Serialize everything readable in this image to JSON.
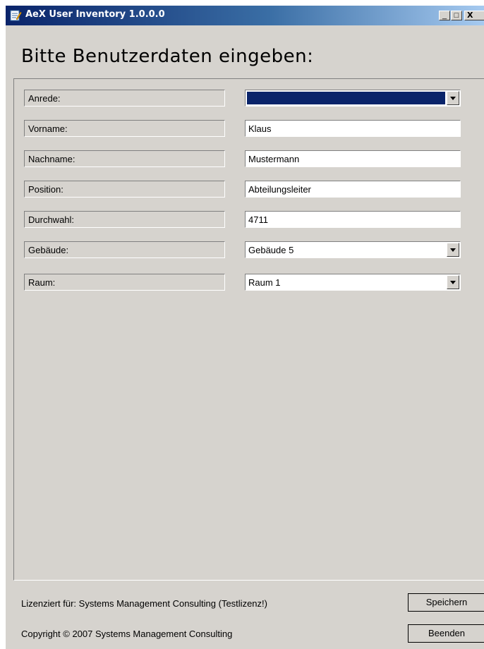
{
  "window": {
    "title": "AeX User Inventory 1.0.0.0",
    "controls": {
      "minimize": "_",
      "maximize": "□",
      "close": "X"
    }
  },
  "heading": "Bitte Benutzerdaten eingeben:",
  "form": {
    "fields": [
      {
        "label": "Anrede:",
        "type": "select",
        "value": "",
        "selected_highlight": true
      },
      {
        "label": "Vorname:",
        "type": "text",
        "value": "Klaus"
      },
      {
        "label": "Nachname:",
        "type": "text",
        "value": "Mustermann"
      },
      {
        "label": "Position:",
        "type": "text",
        "value": "Abteilungsleiter"
      },
      {
        "label": "Durchwahl:",
        "type": "text",
        "value": "4711"
      },
      {
        "label": "Gebäude:",
        "type": "select",
        "value": "Gebäude 5"
      },
      {
        "label": "Raum:",
        "type": "select",
        "value": "Raum 1"
      }
    ]
  },
  "footer": {
    "license": "Lizenziert für: Systems Management Consulting (Testlizenz!)",
    "copyright": "Copyright © 2007 Systems Management Consulting",
    "save_label": "Speichern",
    "exit_label": "Beenden"
  },
  "colors": {
    "titlebar_start": "#0a246a",
    "titlebar_end": "#a6caf0",
    "window_bg": "#d6d3ce",
    "selection": "#0a246a"
  },
  "icons": {
    "app": "notepad-pencil-icon"
  }
}
